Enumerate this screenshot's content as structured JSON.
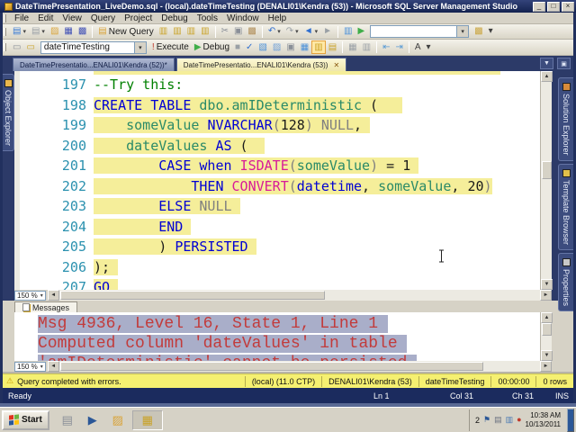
{
  "window": {
    "title": "DateTimePresentation_LiveDemo.sql - (local).dateTimeTesting (DENALI01\\Kendra (53)) - Microsoft SQL Server Management Studio",
    "controls": [
      {
        "name": "minimize-button",
        "glyph": "_"
      },
      {
        "name": "restore-button",
        "glyph": "□"
      },
      {
        "name": "close-button",
        "glyph": "×"
      }
    ]
  },
  "menu": {
    "items": [
      "File",
      "Edit",
      "View",
      "Query",
      "Project",
      "Debug",
      "Tools",
      "Window",
      "Help"
    ]
  },
  "toolbar1": [
    {
      "kind": "icon",
      "name": "new-file-icon",
      "glyph": "▤",
      "color": "#3a7bd5",
      "dd": true
    },
    {
      "kind": "icon",
      "name": "new-project-icon",
      "glyph": "▤",
      "color": "#9aa0a6",
      "dd": true
    },
    {
      "kind": "icon",
      "name": "open-file-icon",
      "glyph": "▨",
      "color": "#d9a43b"
    },
    {
      "kind": "icon",
      "name": "save-icon",
      "glyph": "▦",
      "color": "#4050b5"
    },
    {
      "kind": "icon",
      "name": "save-all-icon",
      "glyph": "▩",
      "color": "#4050b5"
    },
    {
      "kind": "sep"
    },
    {
      "kind": "labeled",
      "name": "new-query-button",
      "glyph": "▤",
      "color": "#d9a43b",
      "label": "New Query"
    },
    {
      "kind": "icon",
      "name": "database-engine-query-icon",
      "glyph": "▥",
      "color": "#c9a227"
    },
    {
      "kind": "icon",
      "name": "analysis-services-mdx-query-icon",
      "glyph": "▥",
      "color": "#c9a227"
    },
    {
      "kind": "icon",
      "name": "analysis-services-dmx-query-icon",
      "glyph": "▥",
      "color": "#c9a227"
    },
    {
      "kind": "icon",
      "name": "analysis-services-xmla-query-icon",
      "glyph": "▥",
      "color": "#c9a227"
    },
    {
      "kind": "sep"
    },
    {
      "kind": "icon",
      "name": "cut-icon",
      "glyph": "✂",
      "color": "#8a8f98"
    },
    {
      "kind": "icon",
      "name": "copy-icon",
      "glyph": "▣",
      "color": "#8a8f98"
    },
    {
      "kind": "icon",
      "name": "paste-icon",
      "glyph": "▩",
      "color": "#b08d57"
    },
    {
      "kind": "sep"
    },
    {
      "kind": "icon",
      "name": "undo-icon",
      "glyph": "↶",
      "color": "#2f6fd0",
      "dd": true
    },
    {
      "kind": "icon",
      "name": "redo-icon",
      "glyph": "↷",
      "color": "#9aa0a6",
      "dd": true
    },
    {
      "kind": "icon",
      "name": "navigate-backward-icon",
      "glyph": "◄",
      "color": "#2f6fd0",
      "dd": true
    },
    {
      "kind": "icon",
      "name": "navigate-forward-icon",
      "glyph": "►",
      "color": "#9aa0a6"
    },
    {
      "kind": "sep"
    },
    {
      "kind": "icon",
      "name": "activity-monitor-icon",
      "glyph": "▥",
      "color": "#4a90d9"
    },
    {
      "kind": "icon",
      "name": "start-debugging-icon",
      "glyph": "▶",
      "color": "#3fae49"
    },
    {
      "kind": "combo",
      "name": "search-combo",
      "value": "",
      "width": 110
    },
    {
      "kind": "icon",
      "name": "help-icon",
      "glyph": "▩",
      "color": "#caa53f"
    },
    {
      "kind": "icon",
      "name": "toolbar-options-icon",
      "glyph": "▾",
      "color": "#404040"
    }
  ],
  "toolbar2": [
    {
      "kind": "icon",
      "name": "connect-icon",
      "glyph": "▭",
      "color": "#8a8f98"
    },
    {
      "kind": "icon",
      "name": "change-connection-icon",
      "glyph": "▭",
      "color": "#c9a227"
    },
    {
      "kind": "combo",
      "name": "available-databases-combo",
      "value": "dateTimeTesting",
      "width": 118
    },
    {
      "kind": "labeled",
      "name": "execute-button",
      "glyph": "!",
      "color": "#c0392b",
      "label": "Execute"
    },
    {
      "kind": "labeled",
      "name": "debug-button",
      "glyph": "▶",
      "color": "#3fae49",
      "label": "Debug"
    },
    {
      "kind": "icon",
      "name": "stop-icon",
      "glyph": "■",
      "color": "#9aa0a6"
    },
    {
      "kind": "icon",
      "name": "parse-icon",
      "glyph": "✓",
      "color": "#2f6fd0"
    },
    {
      "kind": "icon",
      "name": "display-estimated-plan-icon",
      "glyph": "▧",
      "color": "#4a90d9"
    },
    {
      "kind": "icon",
      "name": "query-designer-icon",
      "glyph": "▨",
      "color": "#6fa0d9"
    },
    {
      "kind": "icon",
      "name": "specify-template-parameters-icon",
      "glyph": "▣",
      "color": "#8a8f98"
    },
    {
      "kind": "icon",
      "name": "include-actual-plan-icon",
      "glyph": "▦",
      "color": "#4a90d9"
    },
    {
      "kind": "icon",
      "name": "include-client-statistics-icon",
      "glyph": "▥",
      "color": "#c9a227",
      "active": true
    },
    {
      "kind": "icon",
      "name": "results-to-text-icon",
      "glyph": "▤",
      "color": "#c9a227"
    },
    {
      "kind": "sep"
    },
    {
      "kind": "icon",
      "name": "results-to-grid-icon",
      "glyph": "▦",
      "color": "#9aa0a6"
    },
    {
      "kind": "icon",
      "name": "results-to-file-icon",
      "glyph": "▥",
      "color": "#9aa0a6"
    },
    {
      "kind": "sep"
    },
    {
      "kind": "icon",
      "name": "decrease-indent-icon",
      "glyph": "⇤",
      "color": "#5a9bd5"
    },
    {
      "kind": "icon",
      "name": "increase-indent-icon",
      "glyph": "⇥",
      "color": "#5a9bd5"
    },
    {
      "kind": "sep"
    },
    {
      "kind": "icon",
      "name": "sqlcmd-mode-icon",
      "glyph": "A",
      "color": "#404040"
    },
    {
      "kind": "icon",
      "name": "overflow-chevron-icon",
      "glyph": "▾",
      "color": "#404040"
    }
  ],
  "doc_tabs": [
    {
      "label": "DateTimePresentatio...ENALI01\\Kendra (52))*",
      "active": false
    },
    {
      "label": "DateTimePresentatio...ENALI01\\Kendra (53))",
      "active": true,
      "close_glyph": "✕"
    }
  ],
  "left_tabs": [
    {
      "name": "object-explorer",
      "label": "Object Explorer",
      "icon_color": "#e8b64c"
    }
  ],
  "right_tabs": [
    {
      "name": "solution-explorer",
      "label": "Solution Explorer",
      "icon_color": "#d98b3a"
    },
    {
      "name": "template-browser",
      "label": "Template Browser",
      "icon_color": "#e0c04a"
    },
    {
      "name": "properties",
      "label": "Properties",
      "icon_color": "#c8c8c8"
    }
  ],
  "editor": {
    "zoom": "150 %",
    "lines": [
      {
        "num": "197",
        "hl": false,
        "segs": [
          [
            "--Try this:",
            "comment"
          ]
        ]
      },
      {
        "num": "198",
        "hl": true,
        "segs": [
          [
            "CREATE TABLE",
            "kw"
          ],
          [
            " ",
            "plain"
          ],
          [
            "dbo.amIDeterministic",
            "ident"
          ],
          [
            " (",
            "plain"
          ]
        ],
        "pad": "   "
      },
      {
        "num": "199",
        "hl": true,
        "segs": [
          [
            "    ",
            "plain"
          ],
          [
            "someValue",
            "ident"
          ],
          [
            " ",
            "plain"
          ],
          [
            "NVARCHAR",
            "kw"
          ],
          [
            "(",
            "gray"
          ],
          [
            "128",
            "plain"
          ],
          [
            ")",
            "gray"
          ],
          [
            " ",
            "plain"
          ],
          [
            "NULL",
            "gray"
          ],
          [
            ",",
            "plain"
          ]
        ],
        "pad": " "
      },
      {
        "num": "200",
        "hl": true,
        "segs": [
          [
            "    ",
            "plain"
          ],
          [
            "dateValues",
            "ident"
          ],
          [
            " ",
            "plain"
          ],
          [
            "AS",
            "kw"
          ],
          [
            " (",
            "plain"
          ]
        ],
        "pad": "  "
      },
      {
        "num": "201",
        "hl": true,
        "segs": [
          [
            "        ",
            "plain"
          ],
          [
            "CASE",
            "kw"
          ],
          [
            " ",
            "plain"
          ],
          [
            "when",
            "kw"
          ],
          [
            " ",
            "plain"
          ],
          [
            "ISDATE",
            "fn"
          ],
          [
            "(",
            "gray"
          ],
          [
            "someValue",
            "ident"
          ],
          [
            ")",
            "gray"
          ],
          [
            " = ",
            "plain"
          ],
          [
            "1",
            "plain"
          ]
        ],
        "pad": " "
      },
      {
        "num": "202",
        "hl": true,
        "segs": [
          [
            "            ",
            "plain"
          ],
          [
            "THEN",
            "kw"
          ],
          [
            " ",
            "plain"
          ],
          [
            "CONVERT",
            "fn"
          ],
          [
            "(",
            "gray"
          ],
          [
            "datetime",
            "kw"
          ],
          [
            ", ",
            "plain"
          ],
          [
            "someValue",
            "ident"
          ],
          [
            ", ",
            "plain"
          ],
          [
            "20",
            "plain"
          ],
          [
            ")",
            "gray"
          ]
        ]
      },
      {
        "num": "203",
        "hl": true,
        "segs": [
          [
            "        ",
            "plain"
          ],
          [
            "ELSE",
            "kw"
          ],
          [
            " ",
            "plain"
          ],
          [
            "NULL",
            "gray"
          ]
        ],
        "pad": " "
      },
      {
        "num": "204",
        "hl": true,
        "segs": [
          [
            "        ",
            "plain"
          ],
          [
            "END",
            "kw"
          ]
        ],
        "pad": " "
      },
      {
        "num": "205",
        "hl": true,
        "segs": [
          [
            "        ",
            "plain"
          ],
          [
            ") ",
            "plain"
          ],
          [
            "PERSISTED",
            "kw"
          ]
        ],
        "pad": " "
      },
      {
        "num": "206",
        "hl": true,
        "segs": [
          [
            ");",
            "plain"
          ]
        ],
        "pad": " "
      },
      {
        "num": "207",
        "hl": true,
        "segs": [
          [
            "GO",
            "kw"
          ]
        ],
        "pad": " "
      }
    ]
  },
  "messages": {
    "tab_label": "Messages",
    "zoom": "150 %",
    "lines": [
      "Msg 4936, Level 16, State 1, Line 1",
      "Computed column 'dateValues' in table",
      "'amIDeterministic' cannot be persisted"
    ]
  },
  "status_yellow": {
    "text": "Query completed with errors.",
    "cells": [
      "(local) (11.0 CTP)",
      "DENALI01\\Kendra (53)",
      "dateTimeTesting",
      "00:00:00",
      "0 rows"
    ]
  },
  "status_navy": {
    "ready": "Ready",
    "ln": "Ln 1",
    "col": "Col 31",
    "ch": "Ch 31",
    "mode": "INS"
  },
  "taskbar": {
    "start_label": "Start",
    "apps": [
      {
        "name": "printer-shortcut",
        "glyph": "▤",
        "color": "#8a8f98"
      },
      {
        "name": "powershell-shortcut",
        "glyph": "▶",
        "color": "#2b5797"
      },
      {
        "name": "folder-shortcut",
        "glyph": "▨",
        "color": "#d9a43b"
      },
      {
        "name": "ssms-taskbar-button",
        "glyph": "▦",
        "color": "#c9a227",
        "pressed": true
      }
    ],
    "tray": {
      "count": "2",
      "icons": [
        {
          "name": "flag-icon",
          "glyph": "⚑",
          "color": "#2b5797"
        },
        {
          "name": "document-icon",
          "glyph": "▤",
          "color": "#6b7280"
        },
        {
          "name": "network-icon",
          "glyph": "▥",
          "color": "#4a7ab5"
        },
        {
          "name": "volume-icon",
          "glyph": "●",
          "color": "#c0392b"
        }
      ],
      "time": "10:38 AM",
      "date": "10/13/2011"
    }
  },
  "syntax_colors": {
    "keyword": "#0000d4",
    "function": "#d81b98",
    "identifier": "#2a8a68",
    "null_gray": "#808080",
    "comment": "#008000",
    "plain": "#1a1a1a",
    "selection": "#f5ee9a",
    "line_number": "#2B91AF",
    "message_text": "#c23b3b",
    "message_selection": "#a9aec9",
    "status_warning_bg": "#f5f071"
  }
}
